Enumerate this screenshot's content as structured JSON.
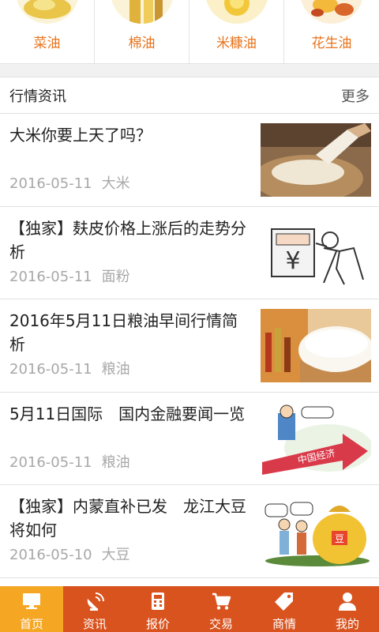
{
  "categories": [
    {
      "label": "菜油",
      "icon": "rapeseed-oil-image"
    },
    {
      "label": "棉油",
      "icon": "cottonseed-oil-image"
    },
    {
      "label": "米糠油",
      "icon": "rice-bran-oil-image"
    },
    {
      "label": "花生油",
      "icon": "peanut-oil-image"
    }
  ],
  "section": {
    "title": "行情资讯",
    "more": "更多"
  },
  "news": [
    {
      "headline": "大米你要上天了吗？",
      "date": "2016-05-11",
      "tag": "大米",
      "image": "rice-sack-photo"
    },
    {
      "headline": "【独家】麸皮价格上涨后的走势分析",
      "date": "2016-05-11",
      "tag": "面粉",
      "image": "price-cartoon"
    },
    {
      "headline": "2016年5月11日粮油早间行情简析",
      "date": "2016-05-11",
      "tag": "粮油",
      "image": "rice-bowl-photo"
    },
    {
      "headline": "5月11日国际　国内金融要闻一览",
      "date": "2016-05-11",
      "tag": "粮油",
      "image": "china-economy-cartoon"
    },
    {
      "headline": "【独家】内蒙直补已发　龙江大豆将如何",
      "date": "2016-05-10",
      "tag": "大豆",
      "image": "soybean-bag-cartoon"
    }
  ],
  "tabs": [
    {
      "label": "首页",
      "icon": "monitor-icon",
      "active": true
    },
    {
      "label": "资讯",
      "icon": "satellite-dish-icon",
      "active": false
    },
    {
      "label": "报价",
      "icon": "calculator-icon",
      "active": false
    },
    {
      "label": "交易",
      "icon": "cart-icon",
      "active": false
    },
    {
      "label": "商情",
      "icon": "tag-icon",
      "active": false
    },
    {
      "label": "我的",
      "icon": "user-icon",
      "active": false
    }
  ],
  "colors": {
    "accent": "#e8731c",
    "tabbar": "#d9531e",
    "tab_active": "#f5a623",
    "meta": "#a8a8a8"
  }
}
